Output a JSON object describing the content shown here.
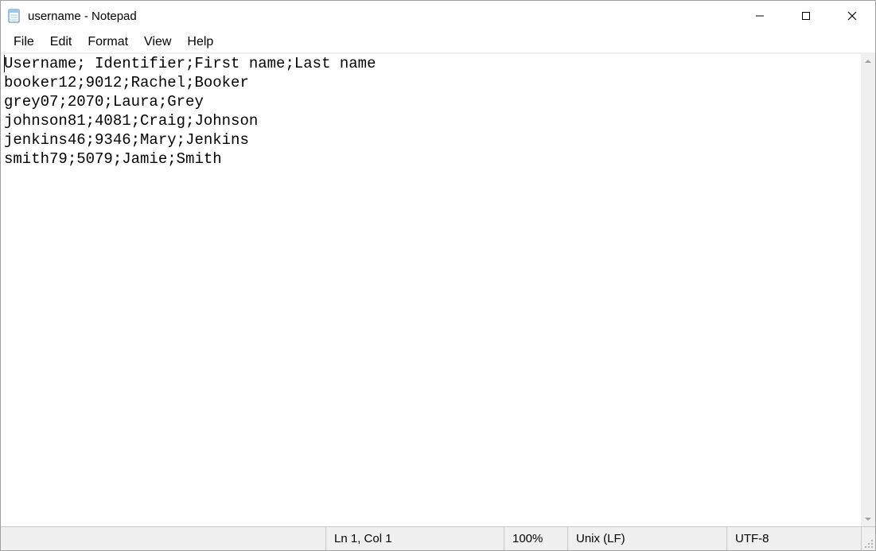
{
  "window": {
    "title": "username - Notepad"
  },
  "menubar": {
    "items": [
      "File",
      "Edit",
      "Format",
      "View",
      "Help"
    ]
  },
  "document": {
    "text": "Username; Identifier;First name;Last name\nbooker12;9012;Rachel;Booker\ngrey07;2070;Laura;Grey\njohnson81;4081;Craig;Johnson\njenkins46;9346;Mary;Jenkins\nsmith79;5079;Jamie;Smith"
  },
  "statusbar": {
    "position": "Ln 1, Col 1",
    "zoom": "100%",
    "eol": "Unix (LF)",
    "encoding": "UTF-8"
  }
}
